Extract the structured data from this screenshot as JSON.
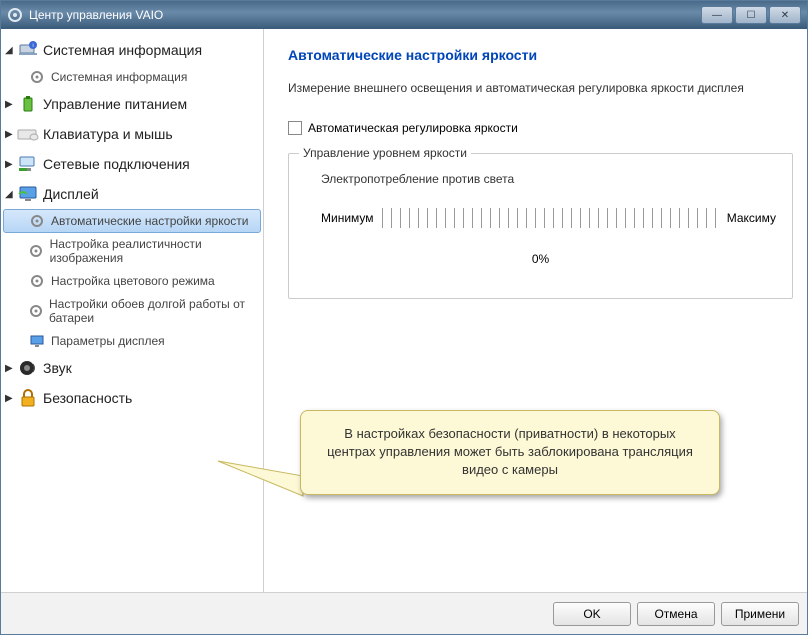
{
  "window": {
    "title": "Центр управления VAIO"
  },
  "sidebar": {
    "items": [
      {
        "label": "Системная информация",
        "expanded": true,
        "children": [
          {
            "label": "Системная информация"
          }
        ]
      },
      {
        "label": "Управление питанием",
        "expanded": false
      },
      {
        "label": "Клавиатура и мышь",
        "expanded": false
      },
      {
        "label": "Сетевые подключения",
        "expanded": false
      },
      {
        "label": "Дисплей",
        "expanded": true,
        "children": [
          {
            "label": "Автоматические настройки яркости",
            "selected": true
          },
          {
            "label": "Настройка реалистичности изображения"
          },
          {
            "label": "Настройка цветового режима"
          },
          {
            "label": "Настройки обоев долгой работы от батареи"
          },
          {
            "label": "Параметры дисплея"
          }
        ]
      },
      {
        "label": "Звук",
        "expanded": false
      },
      {
        "label": "Безопасность",
        "expanded": false
      }
    ]
  },
  "main": {
    "title": "Автоматические настройки яркости",
    "description": "Измерение внешнего освещения и автоматическая регулировка яркости дисплея",
    "checkbox_label": "Автоматическая регулировка яркости",
    "group_title": "Управление уровнем яркости",
    "power_vs_light": "Электропотребление против света",
    "min_label": "Минимум",
    "max_label": "Максиму",
    "percent": "0%"
  },
  "callout": {
    "text": "В настройках безопасности (приватности) в некоторых центрах управления может быть заблокирована трансляция видео с камеры"
  },
  "buttons": {
    "ok": "OK",
    "cancel": "Отмена",
    "apply": "Примени"
  }
}
